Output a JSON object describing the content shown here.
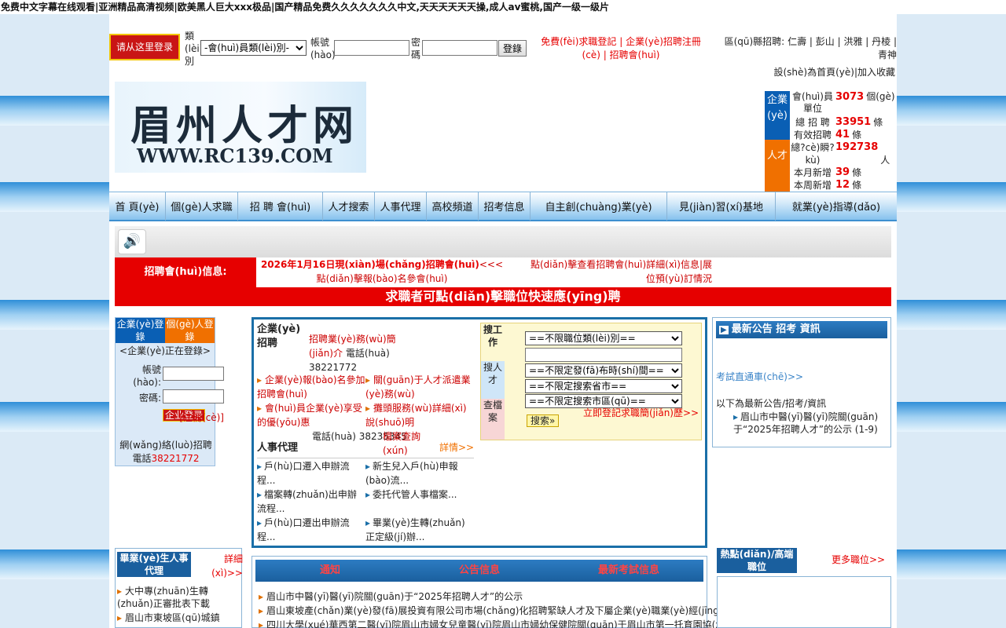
{
  "top_banner": "免费中文字幕在线观看|亚洲精品高清视频|欧美黑人巨大xxx极品|国产精品免费久久久久久久久中文,天天天天天天操,成人av蜜桃,国产一级一级片",
  "login_bar": {
    "login_button": "请从这里登录",
    "type_label": "類(lèi)別",
    "type_select": "-會(huì)員類(lèi)別-",
    "account_label": "帳號(hào)",
    "password_label": "密碼",
    "submit": "登錄",
    "register_personal": "免費(fèi)求職登記",
    "register_company": "企業(yè)招聘注冊(cè)",
    "register_member": "招聘會(huì)",
    "region_label": "區(qū)縣招聘:",
    "regions": [
      "仁壽",
      "彭山",
      "洪雅",
      "丹棱",
      "青神"
    ]
  },
  "header": {
    "set_home": "設(shè)為首頁(yè)",
    "add_fav": "加入收藏",
    "logo_title": "眉州人才网",
    "logo_url": "WWW.RC139.COM"
  },
  "stats": {
    "company_tab": "企業(yè)",
    "talent_tab": "人才",
    "rows": [
      {
        "label": "會(huì)員單位",
        "value": "3073",
        "unit": "個(gè)"
      },
      {
        "label": "總 招 聘",
        "value": "33951",
        "unit": "條"
      },
      {
        "label": "有效招聘",
        "value": "41",
        "unit": "條"
      },
      {
        "label": "總?cè)瞬?kù)",
        "value": "192738",
        "unit": "人"
      },
      {
        "label": "本月新增",
        "value": "39",
        "unit": "條"
      },
      {
        "label": "本周新增",
        "value": "12",
        "unit": "條"
      }
    ]
  },
  "nav": [
    "首 頁(yè)",
    "個(gè)人求職",
    "招 聘 會(huì)",
    "人才搜索",
    "人事代理",
    "高校頻道",
    "招考信息",
    "自主創(chuàng)業(yè)",
    "見(jiàn)習(xí)基地",
    "就業(yè)指導(dǎo)"
  ],
  "fair": {
    "label": "招聘會(huì)信息:",
    "line1": "2026年1月16日現(xiàn)場(chǎng)招聘會(huì)",
    "line1b": "<<<點(diǎn)擊報(bào)名參會(huì)",
    "line2": "點(diǎn)擊查看招聘會(huì)詳細(xì)信息|展位預(yù)訂情況",
    "banner": "求職者可點(diǎn)擊職位快速應(yīng)聘"
  },
  "member_login": {
    "tab_company": "企業(yè)登錄",
    "tab_personal": "個(gè)人登錄",
    "notice": "<企業(yè)正在登錄>",
    "account": "帳號(hào):",
    "password": "密碼:",
    "login": "企业登录",
    "register": "[注冊(cè)]",
    "hotline_label": "網(wǎng)絡(luò)招聘電話",
    "hotline": "38221772"
  },
  "recruit": {
    "title": "企業(yè)招聘",
    "intro": "招聘業(yè)務(wù)簡(jiǎn)介",
    "phone": "電話(huà) 38221772",
    "links": [
      "企業(yè)報(bào)名參加招聘會(huì)",
      "關(guān)于人才派遣業(yè)務(wù)",
      "會(huì)員企業(yè)享受的優(yōu)惠",
      "攤頭服務(wù)詳細(xì)說(shuō)明"
    ],
    "agency_title": "人事代理",
    "agency_phone": "電話(huà) 38235345",
    "archive": "檔案查詢(xún)",
    "more": "詳情>>",
    "agency_links": [
      "戶(hù)口遷入申辦流程...",
      "新生兒入戶(hù)申報(bào)流...",
      "檔案轉(zhuǎn)出申辦流程...",
      "委托代管人事檔案...",
      "戶(hù)口遷出申辦流程...",
      "畢業(yè)生轉(zhuǎn)正定級(jí)辦..."
    ]
  },
  "search": {
    "tab_job": "搜工作",
    "tab_talent": "搜人才",
    "tab_archive": "查檔案",
    "job_type": "==不限職位類(lèi)別==",
    "keyword": "",
    "date": "==不限定發(fā)布時(shí)間==",
    "province": "==不限定搜索省市==",
    "area": "==不限定搜索市區(qū)==",
    "search_btn": "搜索",
    "register_resume": "立即登記求職簡(jiǎn)歷>>"
  },
  "news": {
    "title": "最新公告 招考 資訊",
    "exam_link": "考試直通車(chē)>>",
    "subtitle": "以下為最新公告/招考/資訊",
    "item": "眉山市中醫(yī)醫(yī)院關(guān)于“2025年招聘人才”的公示 (1-9)"
  },
  "grad": {
    "title": "畢業(yè)生人事代理",
    "more": "詳細(xì)>>",
    "items": [
      "大中專(zhuān)生轉(zhuǎn)正審批表下載",
      "眉山市東坡區(qū)城鎮"
    ]
  },
  "notice_tabs": [
    "通知",
    "公告信息",
    "最新考試信息"
  ],
  "notices": [
    "眉山市中醫(yī)醫(yī)院關(guān)于“2025年招聘人才”的公示",
    "眉山東坡產(chǎn)業(yè)發(fā)展投資有限公司市場(chǎng)化招聘緊缺人才及下屬企業(yè)職業(yè)經(jīng)理人的公告",
    "四川大學(xué)華西第二醫(yī)院眉山市婦女兒童醫(yī)院眉山市婦幼保健院關(guān)于眉山市第一托育園協(xié)助聘用工作人員的公示"
  ],
  "hot": {
    "title": "熱點(diǎn)/高端職位",
    "more": "更多職位>>"
  },
  "colors": {
    "accent": "#1a6fa8",
    "red": "#e60000",
    "orange": "#f07000"
  }
}
